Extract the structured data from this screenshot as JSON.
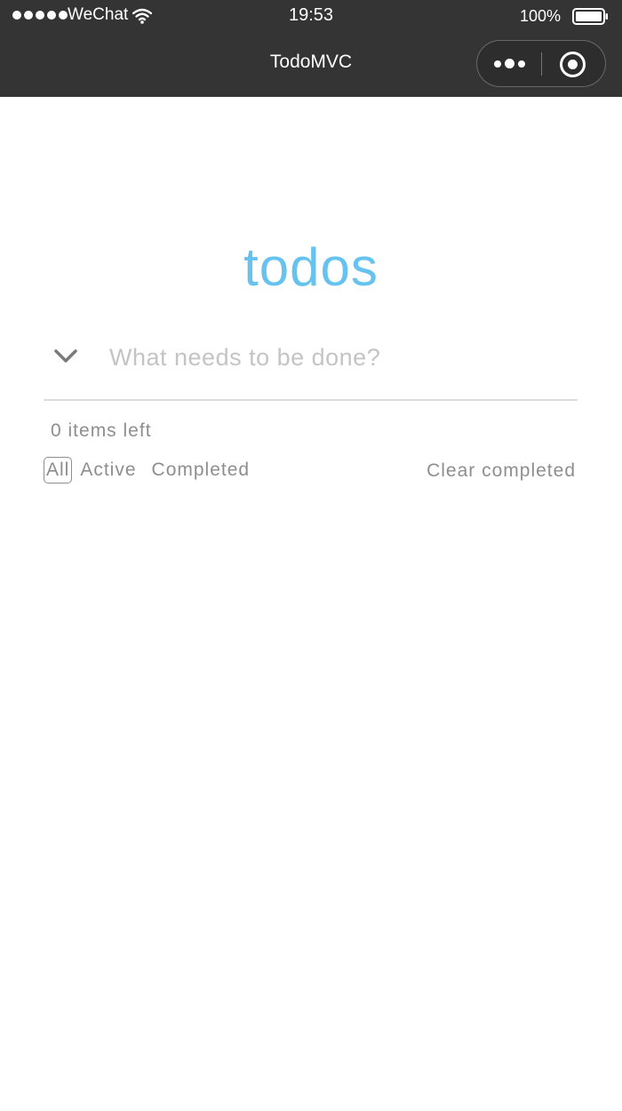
{
  "status_bar": {
    "carrier": "WeChat",
    "time": "19:53",
    "battery": "100%"
  },
  "nav": {
    "title": "TodoMVC",
    "more_icon": "more-dots-icon",
    "close_icon": "close-miniprogram-icon"
  },
  "app": {
    "title": "todos",
    "title_color": "#66c2ee"
  },
  "input": {
    "placeholder": "What needs to be done?",
    "value": "",
    "toggle_icon": "chevron-down-icon"
  },
  "footer": {
    "items_left": "0 items left",
    "filters": [
      "All",
      "Active",
      "Completed"
    ],
    "selected_filter": "All",
    "clear_label": "Clear completed"
  },
  "colors": {
    "nav_bg": "#343434",
    "muted_text": "#8e8e8e",
    "placeholder": "#c4c4c4"
  }
}
